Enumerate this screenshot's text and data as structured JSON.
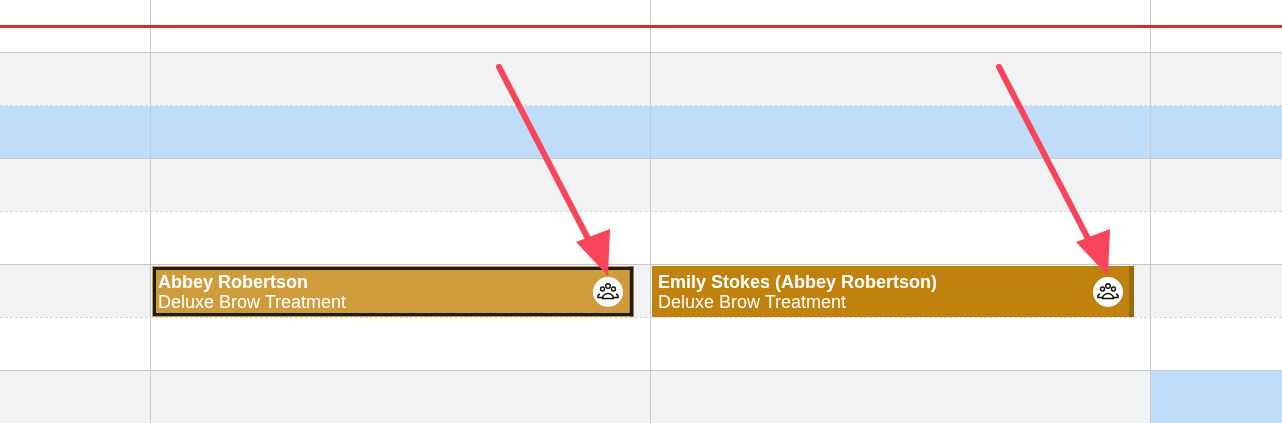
{
  "show_current_time": true,
  "rows": [
    {
      "cells": [
        {
          "kind": "free"
        },
        {
          "kind": "free"
        },
        {
          "kind": "free"
        },
        {
          "kind": "free"
        }
      ]
    },
    {
      "cells": [
        {
          "kind": "free"
        },
        {
          "kind": "free"
        },
        {
          "kind": "free"
        },
        {
          "kind": "free"
        }
      ]
    },
    {
      "cells": [
        {
          "kind": "highlighted"
        },
        {
          "kind": "highlighted"
        },
        {
          "kind": "highlighted"
        },
        {
          "kind": "highlighted"
        }
      ]
    },
    {
      "cells": [
        {
          "kind": "free"
        },
        {
          "kind": "free"
        },
        {
          "kind": "free"
        },
        {
          "kind": "free"
        }
      ]
    },
    {
      "cells": [
        {
          "kind": "free"
        },
        {
          "kind": "free"
        },
        {
          "kind": "free"
        },
        {
          "kind": "free"
        }
      ]
    },
    {
      "cells": [
        {
          "kind": "free"
        },
        {
          "kind": "booked",
          "events": [
            {
              "client": "Abbey Robertson",
              "service": "Deluxe Brow Treatment",
              "color": "#cf9c3c",
              "selected": true,
              "group": true,
              "pointed_at": true
            }
          ]
        },
        {
          "kind": "booked",
          "events": [
            {
              "client": "Emily Stokes (Abbey Robertson)",
              "service": "Deluxe Brow Treatment",
              "color": "#c0820c",
              "selected": false,
              "group": true,
              "pointed_at": true
            }
          ]
        },
        {
          "kind": "free"
        }
      ]
    },
    {
      "cells": [
        {
          "kind": "free"
        },
        {
          "kind": "free"
        },
        {
          "kind": "free"
        },
        {
          "kind": "free"
        }
      ]
    },
    {
      "cells": [
        {
          "kind": "free"
        },
        {
          "kind": "free"
        },
        {
          "kind": "free"
        },
        {
          "kind": "highlighted"
        }
      ]
    }
  ]
}
